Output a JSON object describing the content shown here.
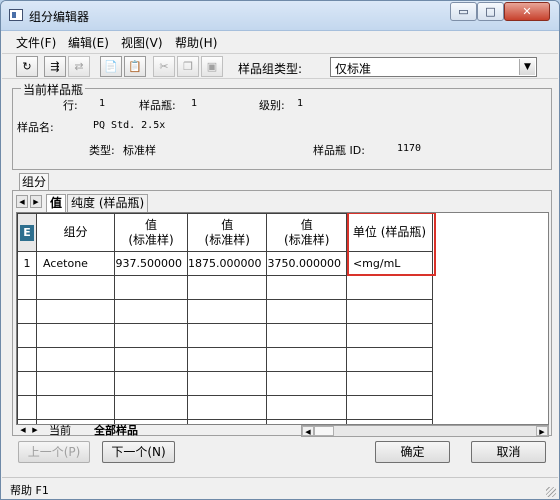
{
  "window": {
    "title": "组分编辑器",
    "min": "▭",
    "max": "□",
    "close": "✕"
  },
  "menu": [
    "文件(F)",
    "编辑(E)",
    "视图(V)",
    "帮助(H)"
  ],
  "toolbar": {
    "icons": [
      "refresh-icon",
      "edit-components-icon",
      "transfer-icon",
      "add-page-icon",
      "copy-page-icon",
      "cut-icon",
      "copy-icon",
      "paste-icon"
    ],
    "group_type_label": "样品组类型:",
    "group_type_value": "仅标准"
  },
  "current_vial": {
    "legend": "当前样品瓶",
    "row_label": "行:",
    "row_value": "1",
    "vial_label": "样品瓶:",
    "vial_value": "1",
    "level_label": "级别:",
    "level_value": "1",
    "name_label": "样品名:",
    "name_value": "PQ Std. 2.5x",
    "type_label": "类型:",
    "type_value": "标准样",
    "vial_id_label": "样品瓶 ID:",
    "vial_id_value": "1170"
  },
  "outer_tab": "组分",
  "inner_tabs": [
    "值",
    "纯度 (样品瓶)"
  ],
  "grid": {
    "headers": [
      "组分",
      "值\n(标准样)",
      "值\n(标准样)",
      "值\n(标准样)",
      "单位 (样品瓶)"
    ],
    "rows": [
      {
        "num": "1",
        "component": "Acetone",
        "v1": "937.500000",
        "v2": "1875.000000",
        "v3": "3750.000000",
        "unit": "<mg/mL"
      }
    ]
  },
  "sheet_tabs": [
    "当前",
    "全部样品"
  ],
  "buttons": {
    "prev": "上一个(P)",
    "next": "下一个(N)",
    "ok": "确定",
    "cancel": "取消"
  },
  "status": "帮助 F1"
}
